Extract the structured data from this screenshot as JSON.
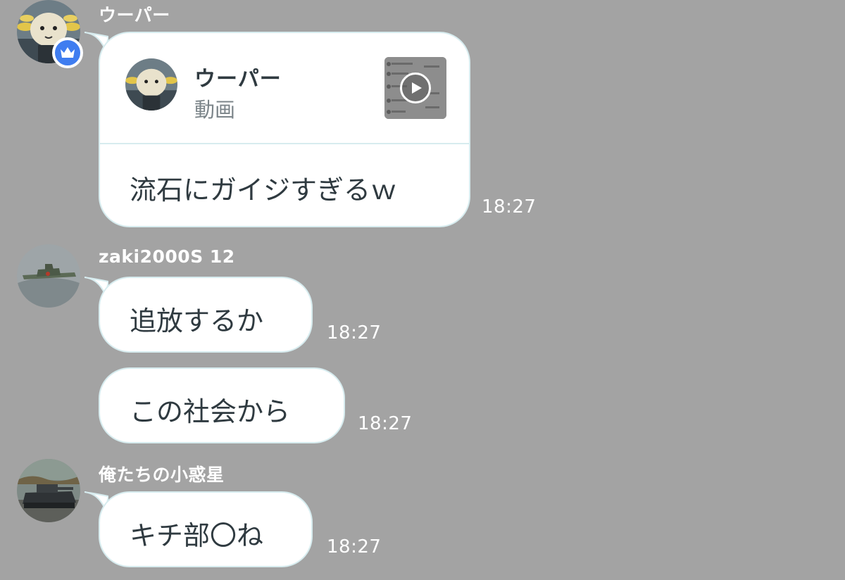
{
  "messages": [
    {
      "sender": "ウーパー",
      "card": {
        "title": "ウーパー",
        "subtitle": "動画"
      },
      "text": "流石にガイジすぎるｗ",
      "time": "18:27"
    },
    {
      "sender": "zaki2000S 12",
      "texts": [
        "追放するか",
        "この社会から"
      ],
      "times": [
        "18:27",
        "18:27"
      ]
    },
    {
      "sender": "俺たちの小惑星",
      "text": "キチ部〇ね",
      "time": "18:27"
    }
  ],
  "icons": {
    "admin_badge": "crown-icon",
    "video_thumbnail": "play-icon"
  },
  "colors": {
    "background": "#a3a3a3",
    "bubble": "#ffffff",
    "bubble_border": "#d7ecef",
    "text": "#2f3a40",
    "badge": "#3f7df0"
  }
}
